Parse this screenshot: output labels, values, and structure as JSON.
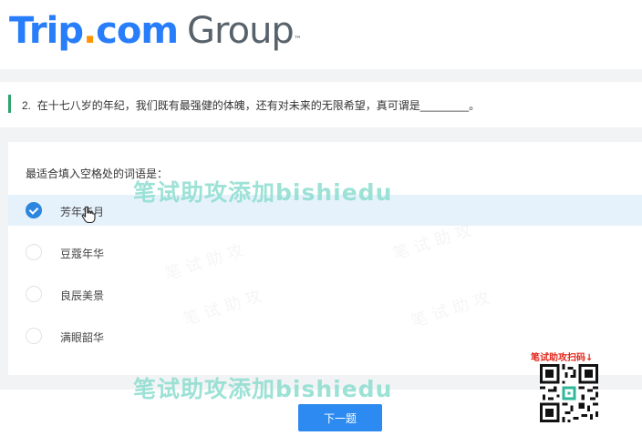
{
  "header": {
    "logo_brand": "Trip",
    "logo_dot": ".",
    "logo_com": "com",
    "logo_group": "Group",
    "logo_tm": "™"
  },
  "question": {
    "number": "2.",
    "text": "在十七八岁的年纪，我们既有最强健的体魄，还有对未来的无限希望，真可谓是________。"
  },
  "answers": {
    "prompt": "最适合填入空格处的词语是：",
    "options": [
      {
        "label": "芳年华月",
        "selected": true
      },
      {
        "label": "豆蔻年华",
        "selected": false
      },
      {
        "label": "良辰美景",
        "selected": false
      },
      {
        "label": "满眼韶华",
        "selected": false
      }
    ]
  },
  "footer": {
    "next_label": "下一题"
  },
  "watermark": {
    "text": "笔试助攻添加bishiedu",
    "qr_caption": "笔试助攻扫码↓"
  }
}
